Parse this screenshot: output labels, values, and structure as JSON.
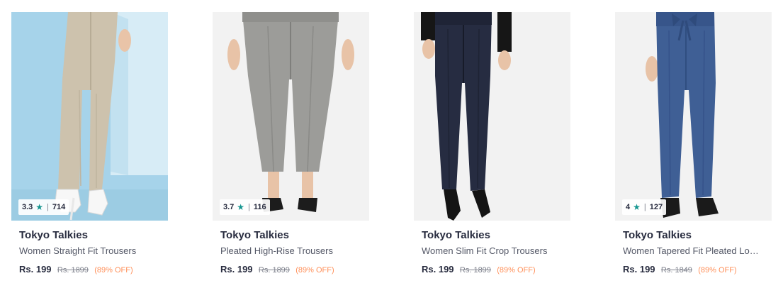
{
  "products": [
    {
      "rating": "3.3",
      "rating_count": "714",
      "brand": "Tokyo Talkies",
      "name": "Women Straight Fit Trousers",
      "price": "Rs. 199",
      "mrp": "Rs. 1899",
      "discount": "(89% OFF)",
      "image": {
        "background": "#a6d3ea",
        "pants_color": "#cdc2ad",
        "shoe": "white-heels"
      }
    },
    {
      "rating": "3.7",
      "rating_count": "116",
      "brand": "Tokyo Talkies",
      "name": "Pleated High-Rise Trousers",
      "price": "Rs. 199",
      "mrp": "Rs. 1899",
      "discount": "(89% OFF)",
      "image": {
        "background": "#f2f2f2",
        "pants_color": "#9c9c99",
        "shoe": "black-sandals"
      }
    },
    {
      "rating": "",
      "rating_count": "",
      "brand": "Tokyo Talkies",
      "name": "Women Slim Fit Crop Trousers",
      "price": "Rs. 199",
      "mrp": "Rs. 1899",
      "discount": "(89% OFF)",
      "image": {
        "background": "#f2f2f2",
        "pants_color": "#262c41",
        "shoe": "black-heels"
      }
    },
    {
      "rating": "4",
      "rating_count": "127",
      "brand": "Tokyo Talkies",
      "name": "Women Tapered Fit Pleated Lo…",
      "price": "Rs. 199",
      "mrp": "Rs. 1849",
      "discount": "(89% OFF)",
      "image": {
        "background": "#f2f2f2",
        "pants_color": "#3f5f95",
        "shoe": "black-sandals"
      }
    }
  ],
  "colors": {
    "star": "#14958f",
    "discount": "#ff905a",
    "brand_text": "#282c3f",
    "muted_text": "#7e818c"
  },
  "icons": {
    "rating": "star-icon"
  }
}
